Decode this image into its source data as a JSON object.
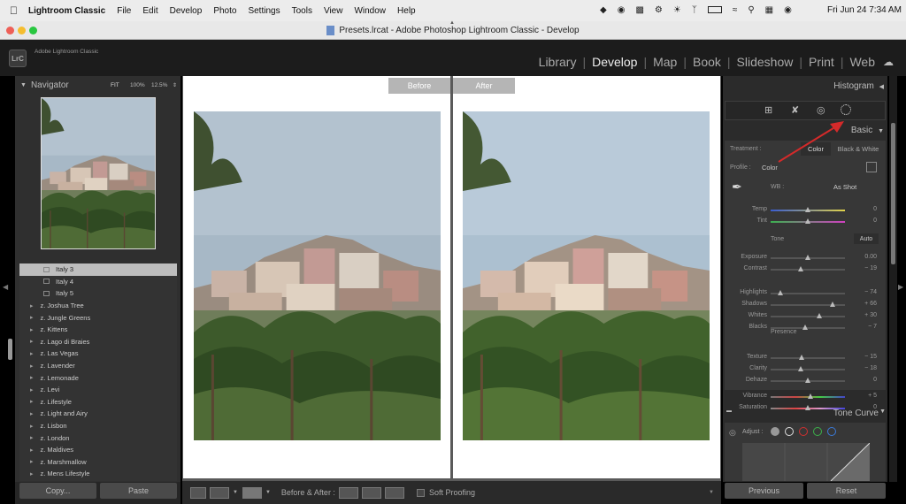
{
  "menubar": {
    "app_name": "Lightroom Classic",
    "items": [
      "File",
      "Edit",
      "Develop",
      "Photo",
      "Settings",
      "Tools",
      "View",
      "Window",
      "Help"
    ],
    "datetime": "Fri Jun 24  7:34 AM"
  },
  "window": {
    "title": "Presets.lrcat - Adobe Photoshop Lightroom Classic - Develop",
    "brand_badge": "LrC",
    "brand_name": "Adobe Lightroom Classic"
  },
  "modules": [
    "Library",
    "Develop",
    "Map",
    "Book",
    "Slideshow",
    "Print",
    "Web"
  ],
  "active_module": "Develop",
  "navigator": {
    "title": "Navigator",
    "zoom_options": [
      "FIT",
      "100%",
      "12.5%"
    ]
  },
  "presets": [
    {
      "label": "Italy 3",
      "type": "preset",
      "selected": true
    },
    {
      "label": "Italy 4",
      "type": "preset"
    },
    {
      "label": "Italy 5",
      "type": "preset"
    },
    {
      "label": "z. Joshua Tree",
      "type": "folder"
    },
    {
      "label": "z. Jungle Greens",
      "type": "folder"
    },
    {
      "label": "z. Kittens",
      "type": "folder"
    },
    {
      "label": "z. Lago di Braies",
      "type": "folder"
    },
    {
      "label": "z. Las Vegas",
      "type": "folder"
    },
    {
      "label": "z. Lavender",
      "type": "folder"
    },
    {
      "label": "z. Lemonade",
      "type": "folder"
    },
    {
      "label": "z. Levi",
      "type": "folder"
    },
    {
      "label": "z. Lifestyle",
      "type": "folder"
    },
    {
      "label": "z. Light and Airy",
      "type": "folder"
    },
    {
      "label": "z. Lisbon",
      "type": "folder"
    },
    {
      "label": "z. London",
      "type": "folder"
    },
    {
      "label": "z. Maldives",
      "type": "folder"
    },
    {
      "label": "z. Marshmallow",
      "type": "folder"
    },
    {
      "label": "z. Mens Lifestyle",
      "type": "folder"
    }
  ],
  "left_buttons": {
    "copy": "Copy...",
    "paste": "Paste"
  },
  "compare": {
    "before_label": "Before",
    "after_label": "After"
  },
  "toolbar": {
    "before_after_label": "Before & After :",
    "soft_proofing": "Soft Proofing"
  },
  "histogram": {
    "title": "Histogram"
  },
  "basic": {
    "title": "Basic",
    "treatment_label": "Treatment :",
    "treatment_options": [
      "Color",
      "Black & White"
    ],
    "profile_label": "Profile :",
    "profile_value": "Color",
    "wb_label": "WB :",
    "wb_value": "As Shot",
    "tone_label": "Tone",
    "auto_label": "Auto",
    "presence_label": "Presence",
    "sliders": [
      {
        "name": "Temp",
        "value": "0",
        "pos": 0.5
      },
      {
        "name": "Tint",
        "value": "0",
        "pos": 0.5
      },
      {
        "name": "Exposure",
        "value": "0.00",
        "pos": 0.5
      },
      {
        "name": "Contrast",
        "value": "− 19",
        "pos": 0.41
      },
      {
        "name": "Highlights",
        "value": "− 74",
        "pos": 0.13
      },
      {
        "name": "Shadows",
        "value": "+ 66",
        "pos": 0.83
      },
      {
        "name": "Whites",
        "value": "+ 30",
        "pos": 0.65
      },
      {
        "name": "Blacks",
        "value": "− 7",
        "pos": 0.46
      },
      {
        "name": "Texture",
        "value": "− 15",
        "pos": 0.42
      },
      {
        "name": "Clarity",
        "value": "− 18",
        "pos": 0.41
      },
      {
        "name": "Dehaze",
        "value": "0",
        "pos": 0.5
      },
      {
        "name": "Vibrance",
        "value": "+ 5",
        "pos": 0.53
      },
      {
        "name": "Saturation",
        "value": "0",
        "pos": 0.5
      }
    ]
  },
  "tone_curve": {
    "title": "Tone Curve",
    "adjust_label": "Adjust :"
  },
  "right_buttons": {
    "previous": "Previous",
    "reset": "Reset"
  },
  "colors": {
    "accent_arrow": "#d42a2a",
    "panel": "#2f2f2f",
    "selected_row": "#bdbdbd"
  }
}
